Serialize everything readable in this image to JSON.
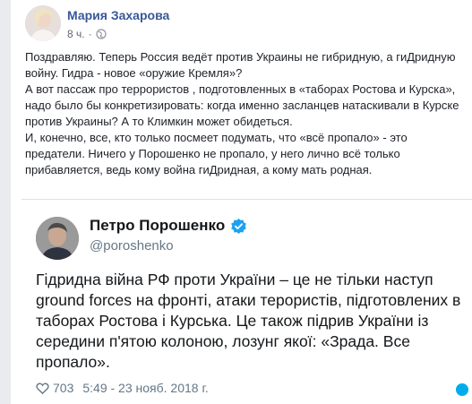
{
  "post": {
    "author_name": "Мария Захарова",
    "time": "8 ч.",
    "privacy_icon": "globe-icon",
    "paragraphs": [
      "Поздравляю. Теперь Россия ведёт против Украины не гибридную, а гиДридную войну. Гидра - новое «оружие Кремля»?",
      "А вот пассаж про террористов , подготовленных в «таборах Ростова и Курска», надо было бы конкретизировать: когда именно засланцев натаскивали в Курске против Украины? А то Климкин может обидеться.",
      "И, конечно, все, кто только посмеет подумать, что «всё пропало» - это предатели. Ничего у Порошенко не пропало, у него лично всё только прибавляется, ведь кому война гиДридная, а кому мать родная."
    ]
  },
  "tweet": {
    "name": "Петро Порошенко",
    "handle": "@poroshenko",
    "text": "Гідридна війна РФ проти України – це не тільки наступ ground forces на фронті, атаки терористів, підготовлених в таборах Ростова і Курська. Це також підрив України із середини п'ятою колоною, лозунг якої: «Зрада. Все пропало».",
    "likes": "703",
    "timestamp": "5:49 - 23 нояб. 2018 г.",
    "verified_icon": "verified-badge-icon",
    "accent_color": "#1da1f2"
  },
  "colors": {
    "author_link": "#385898",
    "body_text": "#1d2129",
    "meta_text": "#616770",
    "page_bg": "#e9ebee"
  }
}
